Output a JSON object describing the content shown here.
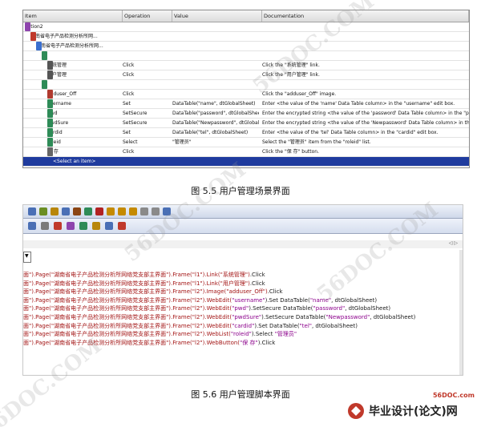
{
  "figure1": {
    "headers": [
      "Item",
      "Operation",
      "Value",
      "Documentation"
    ],
    "rows": [
      {
        "item": "Action2",
        "op": "",
        "val": "",
        "doc": "",
        "indent": 0,
        "icon": "action-icon",
        "twisty": "▼"
      },
      {
        "item": "湖南省电子产品检测分析所网...",
        "op": "",
        "val": "",
        "doc": "",
        "indent": 1,
        "icon": "browser-icon",
        "twisty": "▼"
      },
      {
        "item": "湖南省电子产品检测分析所网...",
        "op": "",
        "val": "",
        "doc": "",
        "indent": 2,
        "icon": "page-icon",
        "twisty": "▼"
      },
      {
        "item": "l1",
        "op": "",
        "val": "",
        "doc": "",
        "indent": 3,
        "icon": "frame-icon",
        "twisty": "▼"
      },
      {
        "item": "系统管理",
        "op": "Click",
        "val": "",
        "doc": "Click the \"系统管理\" link.",
        "indent": 4,
        "icon": "link-icon",
        "twisty": ""
      },
      {
        "item": "用户管理",
        "op": "Click",
        "val": "",
        "doc": "Click the \"用户管理\" link.",
        "indent": 4,
        "icon": "link-icon",
        "twisty": ""
      },
      {
        "item": "l2",
        "op": "",
        "val": "",
        "doc": "",
        "indent": 3,
        "icon": "frame-icon",
        "twisty": "▼"
      },
      {
        "item": "adduser_Off",
        "op": "Click",
        "val": "",
        "doc": "Click the \"adduser_Off\" image.",
        "indent": 4,
        "icon": "image-icon",
        "twisty": ""
      },
      {
        "item": "username",
        "op": "Set",
        "val": "DataTable(\"name\", dtGlobalSheet)",
        "doc": "Enter <the value of the 'name' Data Table column> in the \"username\" edit box.",
        "indent": 4,
        "icon": "editbox-icon",
        "twisty": ""
      },
      {
        "item": "pwd",
        "op": "SetSecure",
        "val": "DataTable(\"password\", dtGlobalSheet)",
        "doc": "Enter the encrypted string <the value of the 'password' Data Table column> in the \"pwd\" edit",
        "indent": 4,
        "icon": "editbox-icon",
        "twisty": ""
      },
      {
        "item": "pwdSure",
        "op": "SetSecure",
        "val": "DataTable(\"Newpassword\", dtGlobalS...",
        "doc": "Enter the encrypted string <the value of the 'Newpassword' Data Table column> in the \"pwdS",
        "indent": 4,
        "icon": "editbox-icon",
        "twisty": ""
      },
      {
        "item": "cardid",
        "op": "Set",
        "val": "DataTable(\"tel\", dtGlobalSheet)",
        "doc": "Enter <the value of the 'tel' Data Table column> in the \"cardid\" edit box.",
        "indent": 4,
        "icon": "editbox-icon",
        "twisty": ""
      },
      {
        "item": "roleid",
        "op": "Select",
        "val": "\"管理员\"",
        "doc": "Select the \"管理员\" item from the \"roleid\" list.",
        "indent": 4,
        "icon": "list-icon",
        "twisty": ""
      },
      {
        "item": "保 存",
        "op": "Click",
        "val": "",
        "doc": "Click the \"保 存\" button.",
        "indent": 4,
        "icon": "button-icon",
        "twisty": ""
      },
      {
        "item": "<Select an item>",
        "op": "",
        "val": "",
        "doc": "",
        "indent": 5,
        "icon": "",
        "twisty": "",
        "selected": true
      }
    ]
  },
  "caption1": "图 5.5 用户管理场景界面",
  "figure2": {
    "combo_label": "▼",
    "scroll_arrows": "◁ ▷",
    "lines": [
      [
        {
          "t": "面\").Page(\"湖南省电子产品检测分析所网络党支部主界面\").Frame(\"l1\").Link(\"系统管理\")",
          "c": "#a31515"
        },
        {
          "t": ".Click",
          "c": "#1a1a1a"
        }
      ],
      [
        {
          "t": "面\").Page(\"湖南省电子产品检测分析所网络党支部主界面\").Frame(\"l1\").Link(\"用户管理\")",
          "c": "#a31515"
        },
        {
          "t": ".Click",
          "c": "#1a1a1a"
        }
      ],
      [
        {
          "t": "面\").Page(\"湖南省电子产品检测分析所网络党支部主界面\").Frame(\"l2\").Image(\"adduser_Off\")",
          "c": "#a31515"
        },
        {
          "t": ".Click",
          "c": "#1a1a1a"
        }
      ],
      [
        {
          "t": "面\").Page(\"湖南省电子产品检测分析所网络党支部主界面\").Frame(\"l2\").WebEdit(",
          "c": "#a31515"
        },
        {
          "t": "\"username\"",
          "c": "#8b008b"
        },
        {
          "t": ").Set ",
          "c": "#1a1a1a"
        },
        {
          "t": "DataTable(",
          "c": "#1a1a1a"
        },
        {
          "t": "\"name\"",
          "c": "#8b008b"
        },
        {
          "t": ", dtGlobalSheet)",
          "c": "#1a1a1a"
        }
      ],
      [
        {
          "t": "面\").Page(\"湖南省电子产品检测分析所网络党支部主界面\").Frame(\"l2\").WebEdit(",
          "c": "#a31515"
        },
        {
          "t": "\"pwd\"",
          "c": "#8b008b"
        },
        {
          "t": ").SetSecure DataTable(",
          "c": "#1a1a1a"
        },
        {
          "t": "\"password\"",
          "c": "#8b008b"
        },
        {
          "t": ", dtGlobalSheet)",
          "c": "#1a1a1a"
        }
      ],
      [
        {
          "t": "面\").Page(\"湖南省电子产品检测分析所网络党支部主界面\").Frame(\"l2\").WebEdit(",
          "c": "#a31515"
        },
        {
          "t": "\"pwdSure\"",
          "c": "#8b008b"
        },
        {
          "t": ").SetSecure DataTable(",
          "c": "#1a1a1a"
        },
        {
          "t": "\"Newpassword\"",
          "c": "#8b008b"
        },
        {
          "t": ", dtGlobalSheet)",
          "c": "#1a1a1a"
        }
      ],
      [
        {
          "t": "面\").Page(\"湖南省电子产品检测分析所网络党支部主界面\").Frame(\"l2\").WebEdit(",
          "c": "#a31515"
        },
        {
          "t": "\"cardid\"",
          "c": "#8b008b"
        },
        {
          "t": ").Set ",
          "c": "#1a1a1a"
        },
        {
          "t": "DataTable(",
          "c": "#1a1a1a"
        },
        {
          "t": "\"tel\"",
          "c": "#8b008b"
        },
        {
          "t": ", dtGlobalSheet)",
          "c": "#1a1a1a"
        }
      ],
      [
        {
          "t": "面\").Page(\"湖南省电子产品检测分析所网络党支部主界面\").Frame(\"l2\").WebList(",
          "c": "#a31515"
        },
        {
          "t": "\"roleid\"",
          "c": "#8b008b"
        },
        {
          "t": ").Select ",
          "c": "#1a1a1a"
        },
        {
          "t": "\"管理员\"",
          "c": "#8b008b"
        }
      ],
      [
        {
          "t": "面\").Page(\"湖南省电子产品检测分析所网络党支部主界面\").Frame(\"l2\").WebButton(",
          "c": "#a31515"
        },
        {
          "t": "\"保 存\"",
          "c": "#8b008b"
        },
        {
          "t": ").Click",
          "c": "#1a1a1a"
        }
      ]
    ]
  },
  "caption2": "图 5.6 用户管理脚本界面",
  "watermarks": [
    "56DOC.COM",
    "56DOC.COM",
    "56DOC.COM",
    "56DOC.COM"
  ],
  "logo": {
    "site": "56DOC.com",
    "title": "毕业设计(论文)网"
  },
  "colors": {
    "selection": "#1f3b9e",
    "code_object": "#a31515",
    "code_string": "#8b008b"
  }
}
